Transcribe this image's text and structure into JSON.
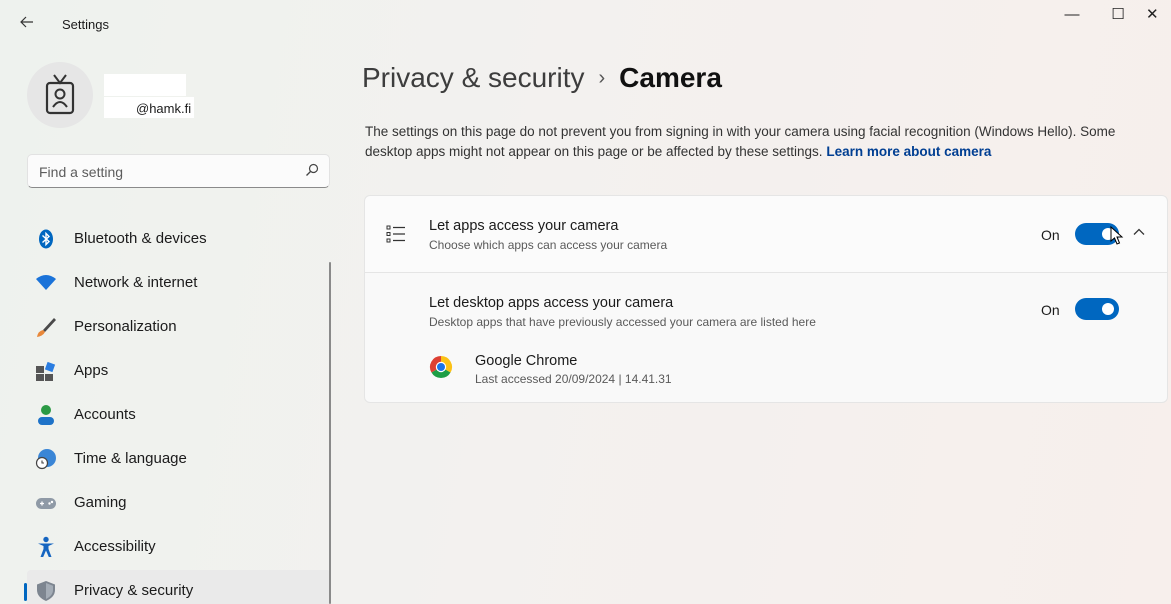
{
  "window": {
    "title": "Settings",
    "back_icon": "back-arrow-icon",
    "minimize_glyph": "—",
    "maximize_glyph": "☐",
    "close_glyph": "✕"
  },
  "profile": {
    "email": "@hamk.fi",
    "avatar_icon": "badge-icon"
  },
  "search": {
    "placeholder": "Find a setting",
    "icon": "search-icon"
  },
  "nav": {
    "items": [
      {
        "label": "Bluetooth & devices",
        "icon": "bluetooth-icon"
      },
      {
        "label": "Network & internet",
        "icon": "wifi-icon"
      },
      {
        "label": "Personalization",
        "icon": "brush-icon"
      },
      {
        "label": "Apps",
        "icon": "apps-icon"
      },
      {
        "label": "Accounts",
        "icon": "person-icon"
      },
      {
        "label": "Time & language",
        "icon": "globe-clock-icon"
      },
      {
        "label": "Gaming",
        "icon": "controller-icon"
      },
      {
        "label": "Accessibility",
        "icon": "accessibility-icon"
      },
      {
        "label": "Privacy & security",
        "icon": "shield-icon"
      }
    ],
    "selected": "Privacy & security"
  },
  "main": {
    "breadcrumb_parent": "Privacy & security",
    "breadcrumb_separator": "›",
    "breadcrumb_current": "Camera",
    "description": "The settings on this page do not prevent you from signing in with your camera using facial recognition (Windows Hello). Some desktop apps might not appear on this page or be affected by these settings.",
    "learn_more": "Learn more about camera",
    "settings": {
      "apps_access": {
        "title": "Let apps access your camera",
        "subtitle": "Choose which apps can access your camera",
        "state": "On",
        "enabled": true,
        "icon": "list-icon"
      },
      "desktop_access": {
        "title": "Let desktop apps access your camera",
        "subtitle": "Desktop apps that have previously accessed your camera are listed here",
        "state": "On",
        "enabled": true
      }
    },
    "apps": [
      {
        "name": "Google Chrome",
        "last_accessed": "Last accessed 20/09/2024  |  14.41.31",
        "icon": "chrome-icon"
      }
    ]
  },
  "colors": {
    "accent": "#0067c0",
    "link": "#003e92"
  }
}
